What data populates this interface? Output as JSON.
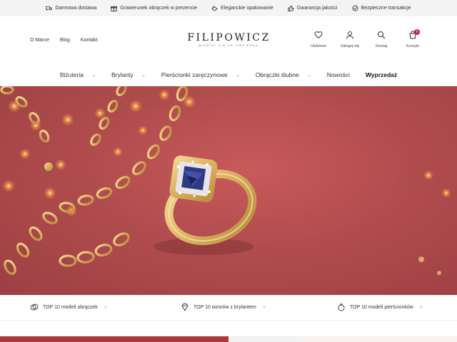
{
  "topbar": {
    "items": [
      {
        "label": "Darmowa dostawa",
        "icon": "truck-icon"
      },
      {
        "label": "Grawerunek obrączek w prezencie",
        "icon": "gift-icon"
      },
      {
        "label": "Eleganckie opakowanie",
        "icon": "package-icon"
      },
      {
        "label": "Gwarancja jakości",
        "icon": "thumbs-up-icon"
      },
      {
        "label": "Bezpieczne transakcje",
        "icon": "shield-check-icon"
      }
    ]
  },
  "header": {
    "links": [
      "O Marce",
      "Blog",
      "Kontakt"
    ],
    "logo": {
      "name": "FILIPOWICZ",
      "tagline": "WIERTAJ SIĘ OD 1983 ROKU"
    },
    "actions": [
      {
        "label": "Ulubione",
        "icon": "heart-icon"
      },
      {
        "label": "Zaloguj się",
        "icon": "user-icon"
      },
      {
        "label": "Szukaj",
        "icon": "search-icon"
      },
      {
        "label": "Koszyk",
        "icon": "cart-icon"
      }
    ],
    "cart_count": "0"
  },
  "nav": {
    "items": [
      {
        "label": "Biżuteria",
        "dropdown": true
      },
      {
        "label": "Brylanty",
        "dropdown": true
      },
      {
        "label": "Pierścionki zaręczynowe",
        "dropdown": true
      },
      {
        "label": "Obrączki ślubne",
        "dropdown": true
      },
      {
        "label": "Nowości",
        "dropdown": false
      },
      {
        "label": "Wyprzedaż",
        "dropdown": false
      }
    ]
  },
  "hero": {
    "background": "#b14c4e",
    "accent_gold": "#e0b866"
  },
  "shortcuts": [
    {
      "label": "TOP 10 modeli obrączek",
      "icon": "rings-icon"
    },
    {
      "label": "TOP 10 wzorów z brylantem",
      "icon": "diamond-icon"
    },
    {
      "label": "TOP 10 modeli pierścionków",
      "icon": "ring-icon"
    }
  ],
  "colors": {
    "topbar_bg": "#f4f4f4",
    "badge": "#c2185b"
  }
}
